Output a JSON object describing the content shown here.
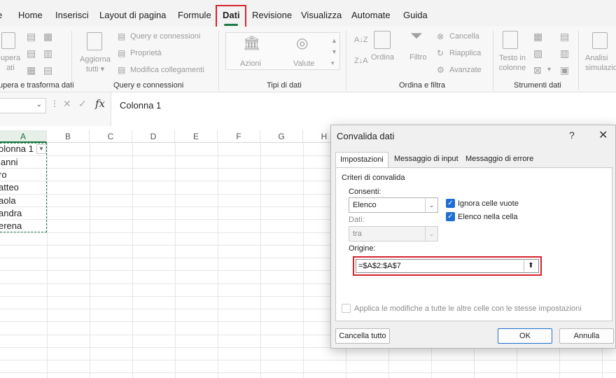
{
  "ribbon_tabs": [
    {
      "label": "Home"
    },
    {
      "label": "Inserisci"
    },
    {
      "label": "Layout di pagina"
    },
    {
      "label": "Formule"
    },
    {
      "label": "Dati"
    },
    {
      "label": "Revisione"
    },
    {
      "label": "Visualizza"
    },
    {
      "label": "Automate"
    },
    {
      "label": "Guida"
    }
  ],
  "ribbon": {
    "recupera": {
      "label_line1": "upera",
      "label_line2": "ati",
      "group_label": "upera e trasforma dati"
    },
    "query": {
      "aggiorna_line1": "Aggiorna",
      "aggiorna_line2": "tutti",
      "query_connessioni": "Query e connessioni",
      "proprieta": "Proprietà",
      "modifica_collegamenti": "Modifica collegamenti",
      "group_label": "Query e connessioni"
    },
    "tipi": {
      "azioni": "Azioni",
      "valute": "Valute",
      "group_label": "Tipi di dati"
    },
    "ordina": {
      "ordina": "Ordina",
      "filtro": "Filtro",
      "cancella": "Cancella",
      "riapplica": "Riapplica",
      "avanzate": "Avanzate",
      "group_label": "Ordina e filtra"
    },
    "strumenti": {
      "testo_line1": "Testo in",
      "testo_line2": "colonne",
      "group_label": "Strumenti dati"
    },
    "analisi": {
      "line1": "Analisi",
      "line2": "simulazio"
    }
  },
  "formula_bar": {
    "fx_label": "fx",
    "content": "Colonna 1"
  },
  "sheet": {
    "columns": [
      "A",
      "B",
      "C",
      "D",
      "E",
      "F",
      "G",
      "H"
    ],
    "cells_a": [
      "olonna 1",
      "ianni",
      "ro",
      "atteo",
      "aola",
      "andra",
      "erena"
    ]
  },
  "dialog": {
    "title": "Convalida dati",
    "help": "?",
    "close": "✕",
    "tabs": [
      "Impostazioni",
      "Messaggio di input",
      "Messaggio di errore"
    ],
    "criteria_title": "Criteri di convalida",
    "consenti_label": "Consenti:",
    "consenti_value": "Elenco",
    "dati_label": "Dati:",
    "dati_value": "tra",
    "ignora_label": "Ignora celle vuote",
    "ignora_checked": true,
    "elenco_label": "Elenco nella cella",
    "elenco_checked": true,
    "origine_label": "Origine:",
    "origine_value": "=$A$2:$A$7",
    "apply_all_label": "Applica le modifiche a tutte le altre celle con le stesse impostazioni",
    "apply_all_checked": false,
    "btn_clear": "Cancella tutto",
    "btn_ok": "OK",
    "btn_cancel": "Annulla"
  },
  "colors": {
    "accent_green": "#1e7a47",
    "highlight_red": "#d6242f",
    "checkbox_blue": "#1f6fd0"
  }
}
